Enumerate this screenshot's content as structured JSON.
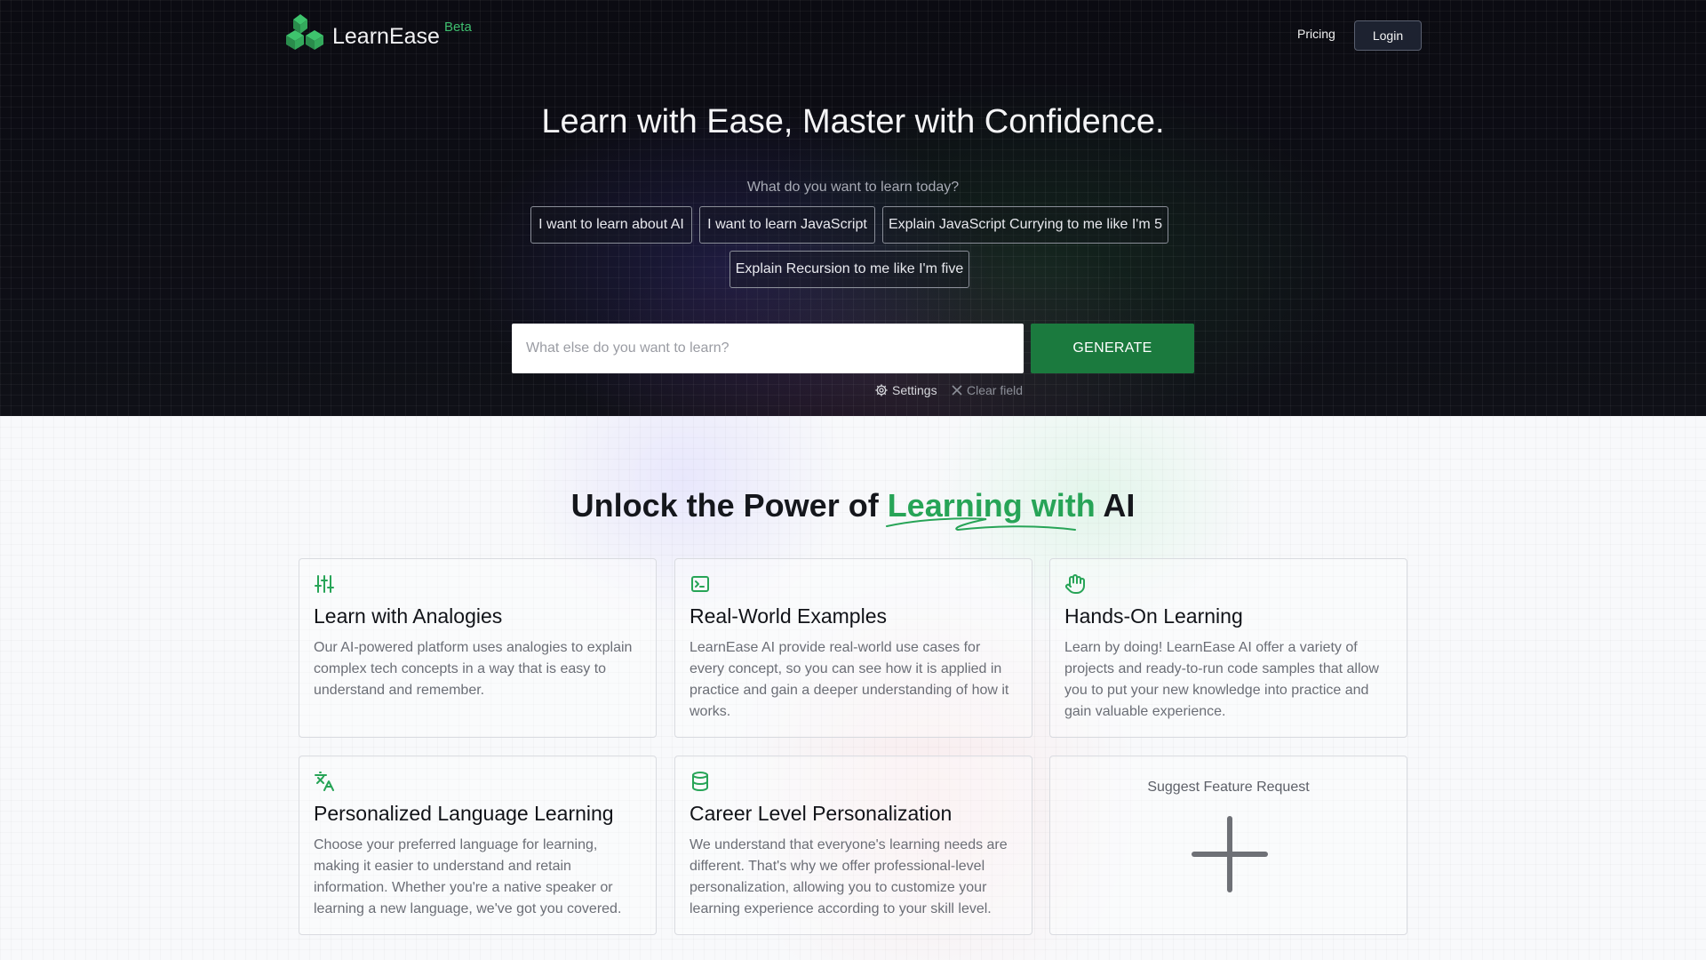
{
  "brand": {
    "name": "LearnEase",
    "badge": "Beta"
  },
  "nav": {
    "pricing": "Pricing",
    "login": "Login"
  },
  "hero": {
    "title": "Learn with Ease, Master with Confidence.",
    "subtitle": "What do you want to learn today?",
    "suggestions": [
      "I want to learn about AI",
      "I want to learn JavaScript",
      "Explain JavaScript Currying to me like I'm 5",
      "Explain Recursion to me like I'm five"
    ],
    "search_placeholder": "What else do you want to learn?",
    "generate_label": "GENERATE",
    "settings_label": "Settings",
    "clear_label": "Clear field"
  },
  "features": {
    "title_prefix": "Unlock the Power of ",
    "title_highlight": "Learning with",
    "title_suffix": " AI",
    "cards": [
      {
        "icon": "sliders-icon",
        "title": "Learn with Analogies",
        "desc": "Our AI-powered platform uses analogies to explain complex tech concepts in a way that is easy to understand and remember."
      },
      {
        "icon": "terminal-icon",
        "title": "Real-World Examples",
        "desc": "LearnEase AI provide real-world use cases for every concept, so you can see how it is applied in practice and gain a deeper understanding of how it works."
      },
      {
        "icon": "hand-icon",
        "title": "Hands-On Learning",
        "desc": "Learn by doing! LearnEase AI offer a variety of projects and ready-to-run code samples that allow you to put your new knowledge into practice and gain valuable experience."
      },
      {
        "icon": "translate-icon",
        "title": "Personalized Language Learning",
        "desc": "Choose your preferred language for learning, making it easier to understand and retain information. Whether you're a native speaker or learning a new language, we've got you covered."
      },
      {
        "icon": "database-icon",
        "title": "Career Level Personalization",
        "desc": "We understand that everyone's learning needs are different. That's why we offer professional-level personalization, allowing you to customize your learning experience according to your skill level."
      }
    ],
    "suggest_label": "Suggest Feature Request"
  },
  "colors": {
    "accent": "#27a457",
    "button": "#1b7a3e"
  }
}
